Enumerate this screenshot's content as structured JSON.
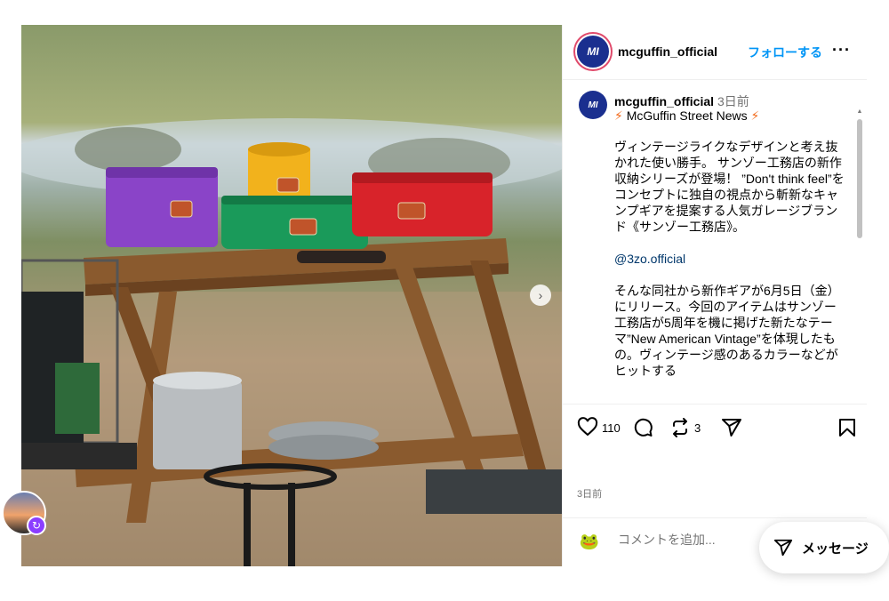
{
  "post": {
    "username": "mcguffin_official",
    "avatar_text": "MI",
    "follow_label": "フォローする",
    "more_icon": "more-horizontal-icon"
  },
  "caption": {
    "username": "mcguffin_official",
    "time": "3日前",
    "title": "McGuffin Street News",
    "paragraph1": "ヴィンテージライクなデザインと考え抜かれた使い勝手。 サンゾー工務店の新作収納シリーズが登場！ ”Don't think feel”をコンセプトに独自の視点から斬新なキャンプギアを提案する人気ガレージブランド《サンゾー工務店》。",
    "mention": "@3zo.official",
    "paragraph2": "そんな同社から新作ギアが6月5日（金）にリリース。今回のアイテムはサンゾー工務店が5周年を機に掲げた新たなテーマ”New American Vintage”を体現したもの。ヴィンテージ感のあるカラーなどがヒットする"
  },
  "actions": {
    "like_count": "110",
    "repost_count": "3",
    "icons": [
      "heart-icon",
      "comment-icon",
      "repost-icon",
      "share-icon",
      "bookmark-icon"
    ]
  },
  "time_ago": "3日前",
  "comment": {
    "placeholder": "コメントを追加...",
    "avatar_glyph": "🐸"
  },
  "dm": {
    "label": "メッセージ"
  },
  "colors": {
    "follow_blue": "#0095f6",
    "avatar_navy": "#1a2f8f",
    "story_ring": "#e04a6b",
    "bag_purple": "#8a44c8",
    "bag_yellow": "#f2b21c",
    "bag_green": "#1a9a5a",
    "bag_red": "#d8232a"
  }
}
